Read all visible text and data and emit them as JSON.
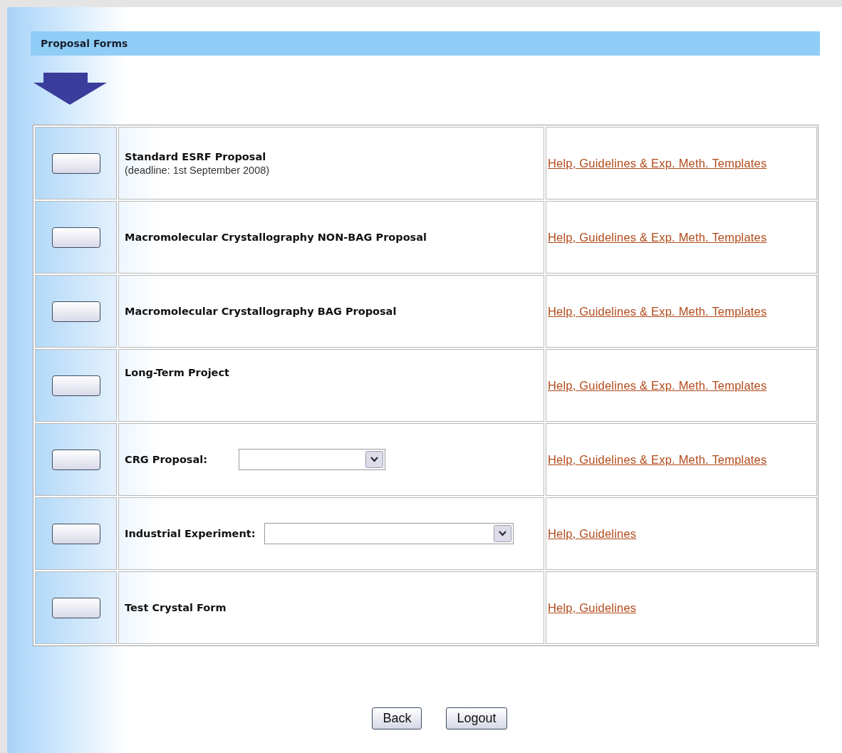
{
  "title": "Proposal Forms",
  "proposals": [
    {
      "kind": "plain",
      "label": "Standard ESRF Proposal",
      "note": "(deadline: 1st September 2008)",
      "link": "Help, Guidelines & Exp. Meth. Templates"
    },
    {
      "kind": "plain",
      "label": "Macromolecular Crystallography NON-BAG Proposal",
      "link": "Help, Guidelines & Exp. Meth. Templates"
    },
    {
      "kind": "plain",
      "label": "Macromolecular Crystallography BAG Proposal",
      "link": "Help, Guidelines & Exp. Meth. Templates"
    },
    {
      "kind": "top",
      "label": "Long-Term Project",
      "link": "Help, Guidelines & Exp. Meth. Templates"
    },
    {
      "kind": "select",
      "label": "CRG Proposal:",
      "link": "Help, Guidelines & Exp. Meth. Templates"
    },
    {
      "kind": "wideselect",
      "label": "Industrial Experiment:",
      "link": "Help, Guidelines"
    },
    {
      "kind": "plain",
      "label": "Test Crystal Form",
      "link": "Help, Guidelines"
    }
  ],
  "buttons": [
    "Back",
    "Logout"
  ]
}
